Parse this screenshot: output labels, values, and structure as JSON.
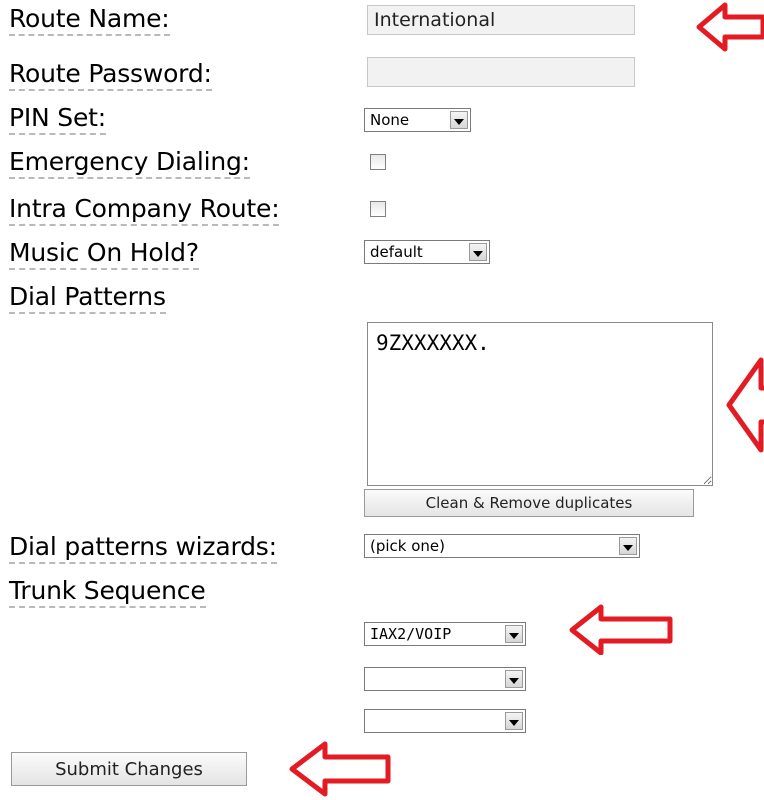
{
  "colors": {
    "arrow": "#e31b23"
  },
  "form": {
    "route_name": {
      "label": "Route Name:",
      "value": "International"
    },
    "route_password": {
      "label": "Route Password:",
      "value": ""
    },
    "pin_set": {
      "label": "PIN Set:",
      "value": "None"
    },
    "emergency_dialing": {
      "label": "Emergency Dialing:",
      "checked": false
    },
    "intra_company_route": {
      "label": "Intra Company Route:",
      "checked": false
    },
    "music_on_hold": {
      "label": "Music On Hold?",
      "value": "default"
    },
    "dial_patterns": {
      "label": "Dial Patterns",
      "value": "9ZXXXXXX.",
      "clean_button": "Clean & Remove duplicates"
    },
    "dial_patterns_wizards": {
      "label": "Dial patterns wizards:",
      "value": "(pick one)"
    },
    "trunk_sequence": {
      "label": "Trunk Sequence",
      "trunks": [
        "IAX2/VOIP",
        "",
        ""
      ]
    },
    "submit_label": "Submit Changes"
  },
  "annotations": {
    "arrows": [
      {
        "name": "arrow-route-name",
        "direction": "left"
      },
      {
        "name": "arrow-dial-patterns",
        "direction": "left"
      },
      {
        "name": "arrow-trunk-sequence",
        "direction": "left"
      },
      {
        "name": "arrow-submit",
        "direction": "left"
      }
    ]
  }
}
